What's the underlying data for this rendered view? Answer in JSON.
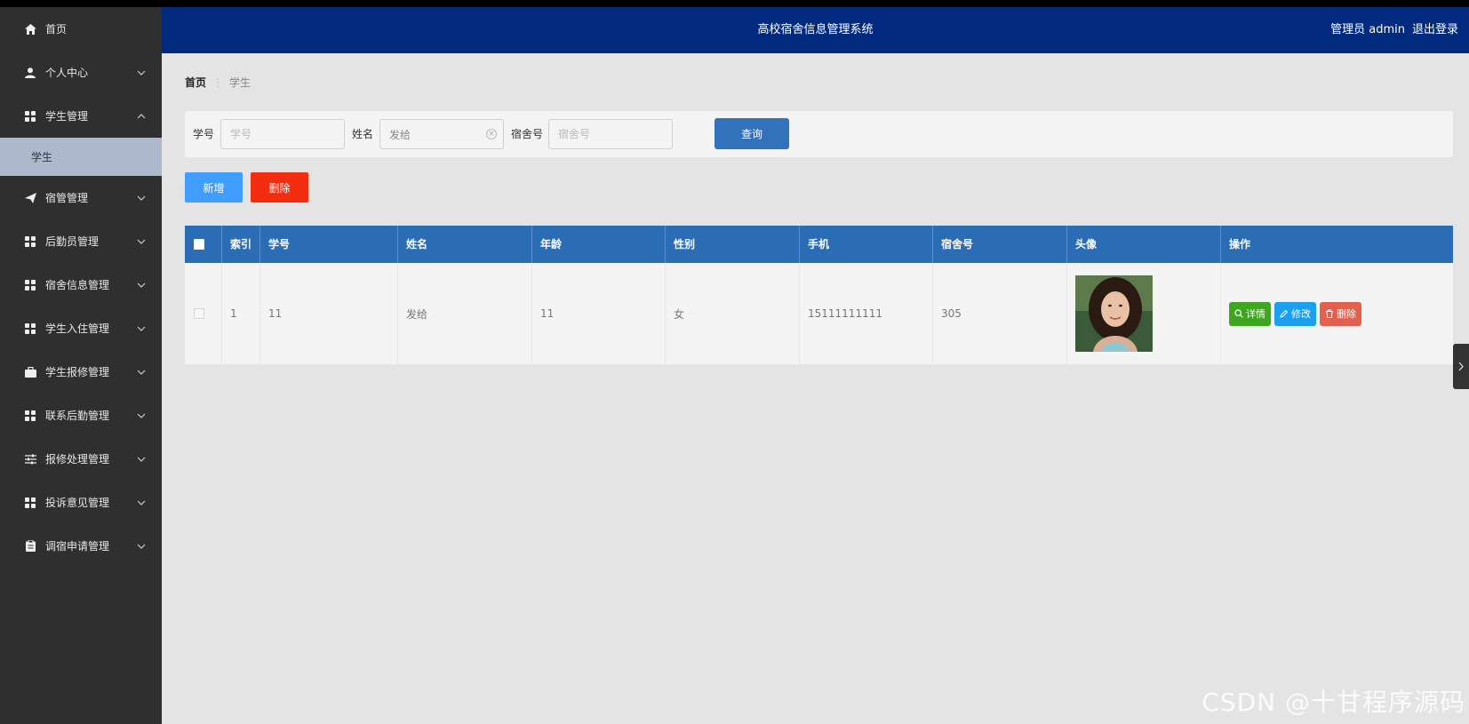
{
  "app": {
    "title": "高校宿舍信息管理系统"
  },
  "user": {
    "greeting": "管理员 admin",
    "logout": "退出登录"
  },
  "sidebar": {
    "items": [
      {
        "label": "首页",
        "icon": "home-icon"
      },
      {
        "label": "个人中心",
        "icon": "person-icon"
      },
      {
        "label": "学生管理",
        "icon": "grid-icon",
        "expanded": true
      },
      {
        "label": "宿管管理",
        "icon": "paper-plane-icon"
      },
      {
        "label": "后勤员管理",
        "icon": "grid-icon"
      },
      {
        "label": "宿舍信息管理",
        "icon": "grid-icon"
      },
      {
        "label": "学生入住管理",
        "icon": "grid-icon"
      },
      {
        "label": "学生报修管理",
        "icon": "briefcase-icon"
      },
      {
        "label": "联系后勤管理",
        "icon": "grid-icon"
      },
      {
        "label": "报修处理管理",
        "icon": "sliders-icon"
      },
      {
        "label": "投诉意见管理",
        "icon": "grid-icon"
      },
      {
        "label": "调宿申请管理",
        "icon": "clipboard-icon"
      }
    ],
    "sub_item": "学生"
  },
  "breadcrumb": {
    "home": "首页",
    "sep": "⋮",
    "current": "学生"
  },
  "search": {
    "student_no_label": "学号",
    "student_no_placeholder": "学号",
    "name_label": "姓名",
    "name_value": "发给",
    "dorm_label": "宿舍号",
    "dorm_placeholder": "宿舍号",
    "query_button": "查询"
  },
  "actions": {
    "add": "新增",
    "delete": "删除"
  },
  "table": {
    "headers": [
      "索引",
      "学号",
      "姓名",
      "年龄",
      "性别",
      "手机",
      "宿舍号",
      "头像",
      "操作"
    ],
    "rows": [
      {
        "index": "1",
        "student_no": "11",
        "name": "发给",
        "age": "11",
        "gender": "女",
        "phone": "15111111111",
        "dorm": "305"
      }
    ],
    "row_actions": {
      "detail": "详情",
      "edit": "修改",
      "delete": "删除"
    }
  },
  "watermark": "CSDN @十甘程序源码",
  "colors": {
    "header": "#022b80",
    "sidebar": "#2f2f2f",
    "table_head": "#2b6db5",
    "query": "#3271bb",
    "add": "#409eff",
    "delete": "#f32d10"
  }
}
